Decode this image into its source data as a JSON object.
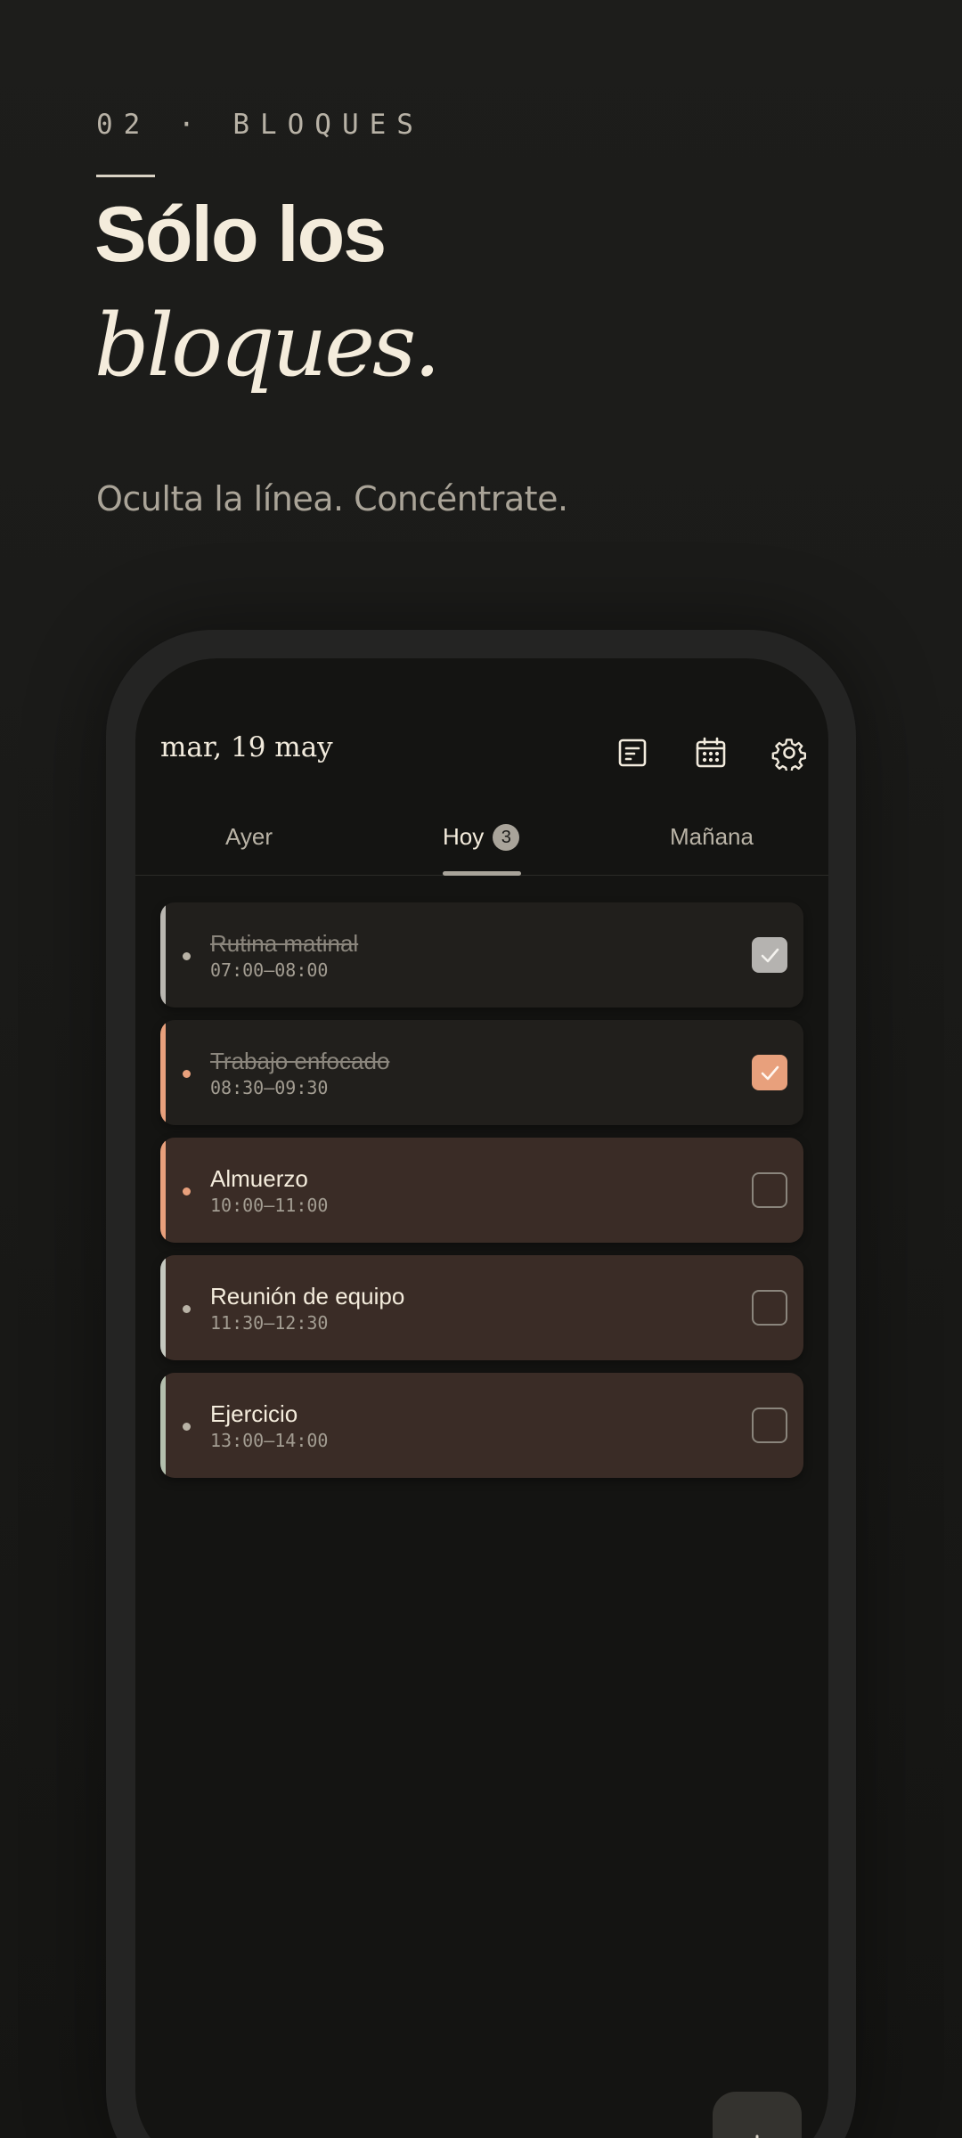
{
  "header": {
    "eyebrow": "02 · BLOQUES",
    "title_line1": "Sólo los",
    "title_line2": "bloques.",
    "subtitle": "Oculta la línea. Concéntrate."
  },
  "app": {
    "date": "mar, 19 may",
    "icons": [
      "notes-icon",
      "calendar-icon",
      "gear-icon"
    ],
    "tabs": [
      {
        "label": "Ayer",
        "active": false
      },
      {
        "label": "Hoy",
        "active": true,
        "badge": "3"
      },
      {
        "label": "Mañana",
        "active": false
      }
    ],
    "blocks": [
      {
        "title": "Rutina matinal",
        "time": "07:00–08:00",
        "done": true,
        "accent": "#b9b6b0",
        "check_color": "#b5b3b0"
      },
      {
        "title": "Trabajo enfocado",
        "time": "08:30–09:30",
        "done": true,
        "accent": "#e8a07c",
        "check_color": "#e8a07c"
      },
      {
        "title": "Almuerzo",
        "time": "10:00–11:00",
        "done": false,
        "accent": "#e8a07c",
        "dot_color": "#e8a07c"
      },
      {
        "title": "Reunión de equipo",
        "time": "11:30–12:30",
        "done": false,
        "accent": "#c4c8bf"
      },
      {
        "title": "Ejercicio",
        "time": "13:00–14:00",
        "done": false,
        "accent": "#b3bfad"
      }
    ],
    "fab_icon": "plus-icon"
  },
  "colors": {
    "background": "#1c1c1a",
    "screen": "#141412",
    "text": "#f4ecdc",
    "accent_peach": "#e8a07c",
    "pending_block": "#3a2c26",
    "done_block": "#211f1c"
  }
}
